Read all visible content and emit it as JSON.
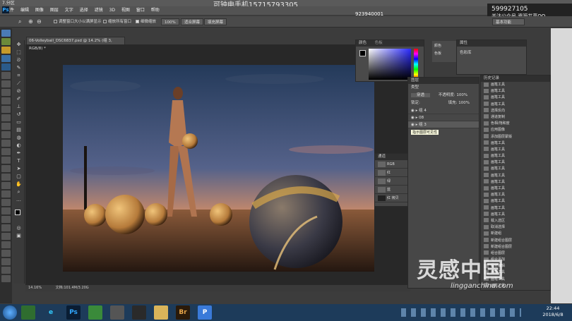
{
  "window_title": "7.分区",
  "watermark_top": "可钟电手机15715793305",
  "watermark_qq": "923940001",
  "watermark_right": {
    "line1": "599927105",
    "line2": "关注公众号  资源共享QQ"
  },
  "menu": [
    "文件",
    "编辑",
    "图像",
    "图层",
    "文字",
    "选择",
    "滤镜",
    "3D",
    "视图",
    "窗口",
    "帮助"
  ],
  "options": {
    "ps": "Ps",
    "chk1": "调整窗口大小以满屏显示",
    "chk2": "缩放所有窗口",
    "chk3": "细微缩放",
    "zoom_value": "100%",
    "fit_btn": "适合屏幕",
    "fill_btn": "填充屏幕",
    "workspace": "基本功能"
  },
  "doc_tab": "06-Volleyball_DSC6837.psd @ 14.2% (组 3, RGB/8) *",
  "status": {
    "zoom": "14.16%",
    "doc": "文档:101.4M/3.20G"
  },
  "color_panel": {
    "tab1": "颜色",
    "tab2": "色板"
  },
  "swatch_panel": {
    "tab": "颜色",
    "sub": "色板"
  },
  "prop_panel": {
    "title": "属性",
    "row1": "色彩库"
  },
  "layers": {
    "title": "图层",
    "kind": "类型",
    "blend": "穿透",
    "opacity_label": "不透明度:",
    "opacity": "100%",
    "fill_label": "填充:",
    "fill": "100%",
    "lock": "锁定:",
    "rows": [
      "组 4",
      "08",
      "组 3"
    ],
    "tooltip": "指示图层可见性"
  },
  "channels": {
    "title": "通道",
    "rows": [
      "RGB",
      "红",
      "绿",
      "蓝",
      "红 拷贝"
    ]
  },
  "history": {
    "title": "历史记录",
    "rows": [
      "画笔工具",
      "画笔工具",
      "画笔工具",
      "画笔工具",
      "选择反向",
      "通道复制",
      "色相/饱和度",
      "应用图像",
      "添加图层蒙版",
      "画笔工具",
      "画笔工具",
      "画笔工具",
      "画笔工具",
      "画笔工具",
      "画笔工具",
      "画笔工具",
      "画笔工具",
      "画笔工具",
      "画笔工具",
      "画笔工具",
      "画笔工具",
      "载入选区",
      "取消选择",
      "新建组",
      "新建组合图层",
      "新建组合图层",
      "组合图层",
      "组合添加",
      "组合编辑",
      "画笔工具",
      "画笔工具",
      "画笔工具"
    ]
  },
  "brand": {
    "cn": "灵感中国",
    "en": "lingganchina.com"
  },
  "clock": {
    "time": "22:44",
    "date": "2018/6/8"
  },
  "taskbar": [
    "Ps",
    "Br",
    "P"
  ],
  "colors": {
    "accent": "#31a8ff",
    "taskbar": "#1d3b5a"
  }
}
